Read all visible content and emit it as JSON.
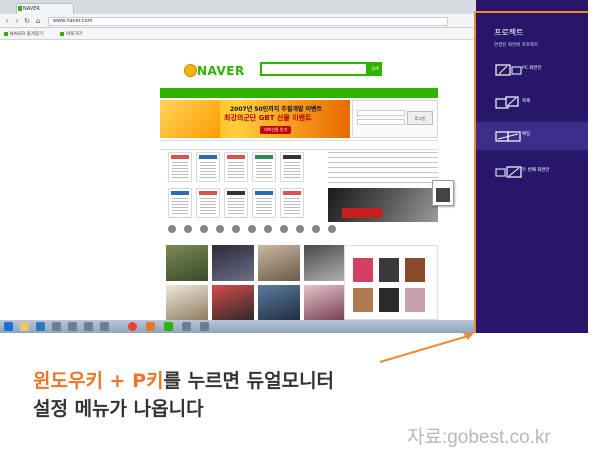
{
  "browser": {
    "tab_label": "NAVER",
    "url": "www.naver.com",
    "bookmarks": [
      "NAVER 즐겨찾기",
      "바로가기"
    ],
    "nav_icons": [
      "back-icon",
      "forward-icon",
      "refresh-icon",
      "home-icon"
    ]
  },
  "naver": {
    "logo": "NAVER",
    "search_button": "검색",
    "banner_line1": "2007년 50인까지 주필개발 이벤트",
    "banner_line2": "최강의군단 GBT 선물 이벤트",
    "banner_button": "대박선물 받기",
    "login_button": "로그인"
  },
  "charm": {
    "title": "프로젝트",
    "subtitle": "연결된 화면에 프로젝트",
    "options": [
      {
        "label": "PC 화면만",
        "icon": "pc-screen-only-icon",
        "selected": false
      },
      {
        "label": "복제",
        "icon": "duplicate-icon",
        "selected": false
      },
      {
        "label": "확장",
        "icon": "extend-icon",
        "selected": true
      },
      {
        "label": "두 번째 화면만",
        "icon": "second-screen-only-icon",
        "selected": false
      }
    ],
    "background": "#27166a",
    "selected_background": "#3d2d8a",
    "outline": "#f08a2c"
  },
  "caption": {
    "line1_highlight": "윈도우키 + P키",
    "line1_rest": "를 누르면 듀얼모니터",
    "line2": "설정 메뉴가 나옵니다",
    "source": "자료:gobest.co.kr",
    "highlight_color": "#ee7427"
  }
}
